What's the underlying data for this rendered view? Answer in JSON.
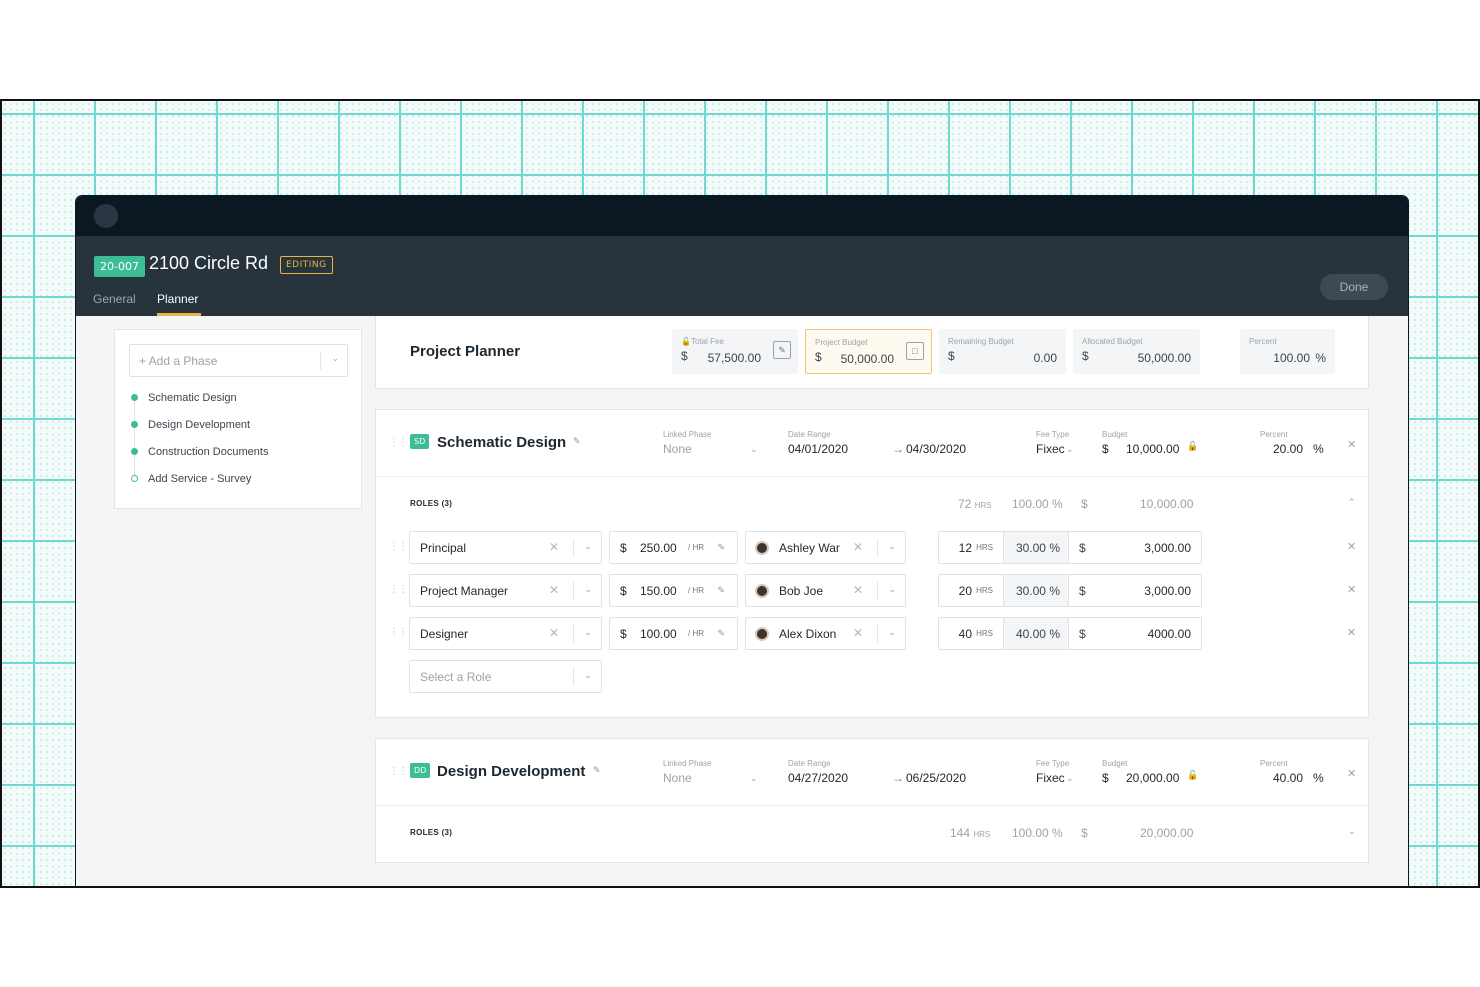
{
  "header": {
    "project_id": "20-007",
    "project_name": "2100 Circle Rd",
    "status": "EDITING",
    "tabs": [
      "General",
      "Planner"
    ],
    "active_tab": "Planner",
    "done_label": "Done"
  },
  "sidebar": {
    "add_phase_placeholder": "+ Add a Phase",
    "phases": [
      {
        "label": "Schematic Design",
        "filled": true
      },
      {
        "label": "Design Development",
        "filled": true
      },
      {
        "label": "Construction Documents",
        "filled": true
      },
      {
        "label": "Add Service - Survey",
        "filled": false
      }
    ]
  },
  "planner": {
    "title": "Project Planner",
    "stats": {
      "total_fee": {
        "label": "Total Fee",
        "currency": "$",
        "value": "57,500.00"
      },
      "project_budget": {
        "label": "Project Budget",
        "currency": "$",
        "value": "50,000.00"
      },
      "remaining_budget": {
        "label": "Remaining Budget",
        "currency": "$",
        "value": "0.00"
      },
      "allocated_budget": {
        "label": "Allocated Budget",
        "currency": "$",
        "value": "50,000.00"
      },
      "percent": {
        "label": "Percent",
        "value": "100.00",
        "unit": "%"
      }
    }
  },
  "labels": {
    "linked_phase": "Linked Phase",
    "date_range": "Date Range",
    "fee_type": "Fee Type",
    "budget": "Budget",
    "percent": "Percent",
    "hrs": "HRS",
    "per_hr": "/ HR",
    "currency": "$",
    "pct_unit": "%",
    "arrow": "→"
  },
  "phase1": {
    "code": "SD",
    "name": "Schematic Design",
    "linked_phase": "None",
    "date_start": "04/01/2020",
    "date_end": "04/30/2020",
    "fee_type": "Fixec",
    "budget": "10,000.00",
    "percent": "20.00",
    "roles_label": "ROLES (3)",
    "totals": {
      "hrs": "72",
      "percent": "100.00 %",
      "amount": "10,000.00"
    },
    "roles": [
      {
        "role": "Principal",
        "rate": "250.00",
        "person": "Ashley War",
        "hrs": "12",
        "percent": "30.00 %",
        "amount": "3,000.00"
      },
      {
        "role": "Project Manager",
        "rate": "150.00",
        "person": "Bob Joe",
        "hrs": "20",
        "percent": "30.00 %",
        "amount": "3,000.00"
      },
      {
        "role": "Designer",
        "rate": "100.00",
        "person": "Alex Dixon",
        "hrs": "40",
        "percent": "40.00 %",
        "amount": "4000.00"
      }
    ],
    "select_role_placeholder": "Select a Role"
  },
  "phase2": {
    "code": "DD",
    "name": "Design Development",
    "linked_phase": "None",
    "date_start": "04/27/2020",
    "date_end": "06/25/2020",
    "fee_type": "Fixec",
    "budget": "20,000.00",
    "percent": "40.00",
    "roles_label": "ROLES (3)",
    "totals": {
      "hrs": "144",
      "percent": "100.00 %",
      "amount": "20,000.00"
    }
  }
}
